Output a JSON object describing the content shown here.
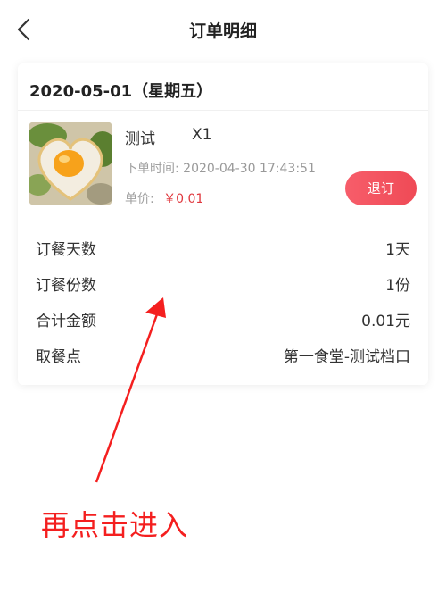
{
  "header": {
    "title": "订单明细",
    "back_icon": "chevron-left-icon"
  },
  "order": {
    "date": "2020-05-01（星期五）",
    "item": {
      "name": "测试",
      "quantity": "X1",
      "order_time_label": "下单时间:",
      "order_time_value": "2020-04-30 17:43:51",
      "price_label": "单价:",
      "price_value": "￥0.01",
      "image": "fried-egg-toast-photo"
    },
    "refund_label": "退订",
    "details": [
      {
        "key": "订餐天数",
        "value": "1天"
      },
      {
        "key": "订餐份数",
        "value": "1份"
      },
      {
        "key": "合计金额",
        "value": "0.01元"
      },
      {
        "key": "取餐点",
        "value": "第一食堂-测试档口"
      }
    ]
  },
  "annotation": {
    "text": "再点击进入",
    "color": "#f41f1f"
  },
  "colors": {
    "accent": "#ef4a56",
    "price": "#e0383e"
  }
}
